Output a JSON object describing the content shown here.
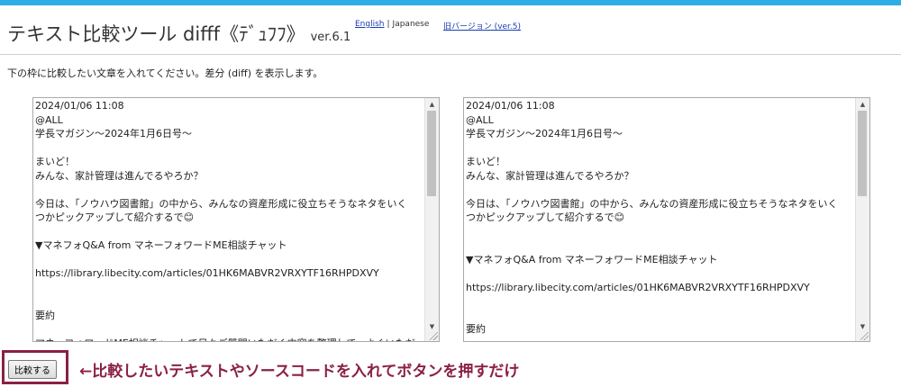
{
  "header": {
    "title": "テキスト比較ツール difff《ﾃﾞｭﾌﾌ》",
    "version": "ver.6.1",
    "lang_english": "English",
    "lang_separator": "|",
    "lang_japanese": "Japanese",
    "old_version": "旧バージョン (ver.5)"
  },
  "instructions": "下の枠に比較したい文章を入れてください。差分 (diff) を表示します。",
  "left_pane": {
    "text": "2024/01/06 11:08\n@ALL\n学長マガジン～2024年1月6日号～\n\nまいど！\nみんな、家計管理は進んでるやろか？\n\n今日は、「ノウハウ図書館」の中から、みんなの資産形成に役立ちそうなネタをいく\nつかピックアップして紹介するで😊\n\n▼マネフォQ&A from マネーフォワードME相談チャット\n\nhttps://library.libecity.com/articles/01HK6MABVR2VRXYTF16RHPDXVY\n\n\n要約\n\nマネーフォワードME相談チャットで日々ご質問いただく内容を整理して、よくいただ"
  },
  "right_pane": {
    "text": "2024/01/06 11:08\n@ALL\n学長マガジン～2024年1月6日号～\n\nまいど！\nみんな、家計管理は進んでるやろか？\n\n今日は、「ノウハウ図書館」の中から、みんなの資産形成に役立ちそうなネタをいく\nつかピックアップして紹介するで😊\n\n\n▼マネフォQ&A from マネーフォワードME相談チャット\n\nhttps://library.libecity.com/articles/01HK6MABVR2VRXYTF16RHPDXVY\n\n\n要約\n\nマネーフォワードME相談チャットで日々ご質問いただく内容を整理して、よくいただ"
  },
  "compare_button": "比較する",
  "annotation": "←比較したいテキストやソースコードを入れてボタンを押すだけ",
  "colors": {
    "accent_bar": "#2eaee6",
    "annotation": "#8a2046",
    "link": "#1a3fb0"
  }
}
